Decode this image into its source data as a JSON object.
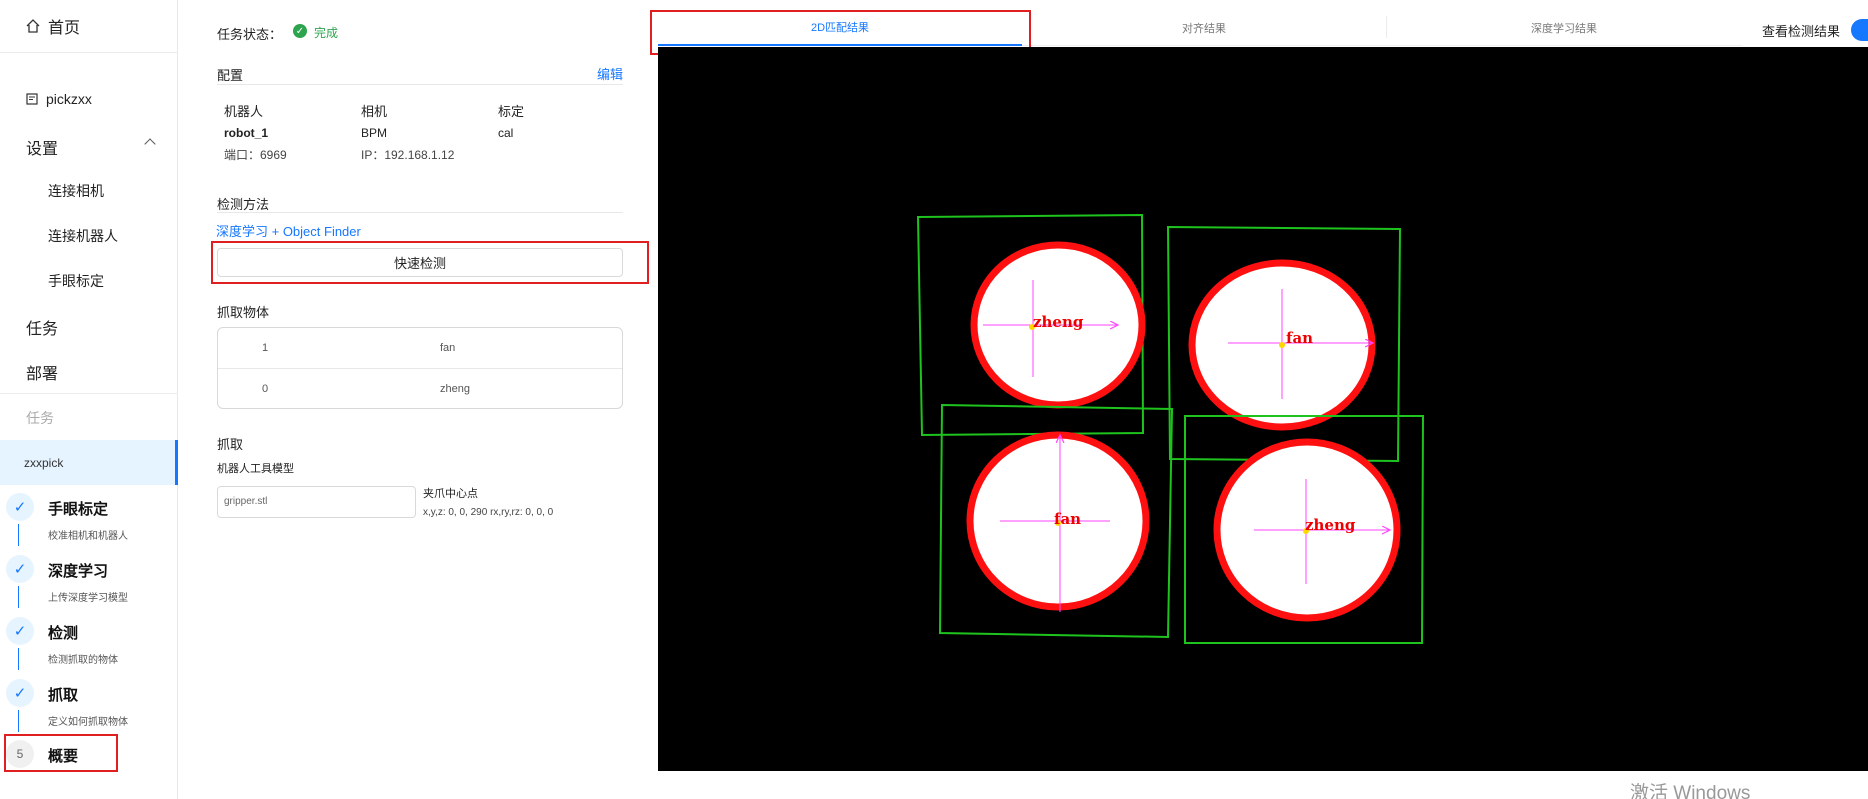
{
  "sidebar": {
    "home": "首页",
    "project": "pickzxx",
    "settings": "设置",
    "settings_items": [
      "连接相机",
      "连接机器人",
      "手眼标定"
    ],
    "task": "任务",
    "deploy": "部署",
    "task_section_label": "任务",
    "active_task": "zxxpick",
    "steps": [
      {
        "title": "手眼标定",
        "desc": "校准相机和机器人",
        "status": "done"
      },
      {
        "title": "深度学习",
        "desc": "上传深度学习模型",
        "status": "done"
      },
      {
        "title": "检测",
        "desc": "检测抓取的物体",
        "status": "done"
      },
      {
        "title": "抓取",
        "desc": "定义如何抓取物体",
        "status": "done"
      },
      {
        "title": "概要",
        "number": "5",
        "status": "current"
      }
    ]
  },
  "panel": {
    "status_label": "任务状态：",
    "status_value": "完成",
    "config_title": "配置",
    "edit_label": "编辑",
    "columns": [
      "机器人",
      "相机",
      "标定"
    ],
    "robot_name": "robot_1",
    "robot_port": "端口：6969",
    "camera_name": "BPM",
    "camera_ip": "IP：192.168.1.12",
    "calibration": "cal",
    "detect_title": "检测方法",
    "detect_method": "深度学习 + Object Finder",
    "quick_detect_button": "快速检测",
    "objects_title": "抓取物体",
    "objects": [
      {
        "id": "1",
        "name": "fan"
      },
      {
        "id": "0",
        "name": "zheng"
      }
    ],
    "grasp_title": "抓取",
    "tool_model_label": "机器人工具模型",
    "tool_model_value": "gripper.stl",
    "gripper_center_label": "夹爪中心点",
    "gripper_center_value": "x,y,z: 0, 0, 290 rx,ry,rz: 0, 0, 0"
  },
  "tabs": [
    "2D匹配结果",
    "对齐结果",
    "深度学习结果"
  ],
  "active_tab": 0,
  "toggle_label": "查看检测结果",
  "toggle_on": true,
  "detections": [
    "zheng",
    "fan",
    "fan",
    "zheng"
  ],
  "watermark": "激活 Windows",
  "colors": {
    "accent": "#1677ff",
    "success": "#2ea44f",
    "highlight": "#e02020"
  }
}
